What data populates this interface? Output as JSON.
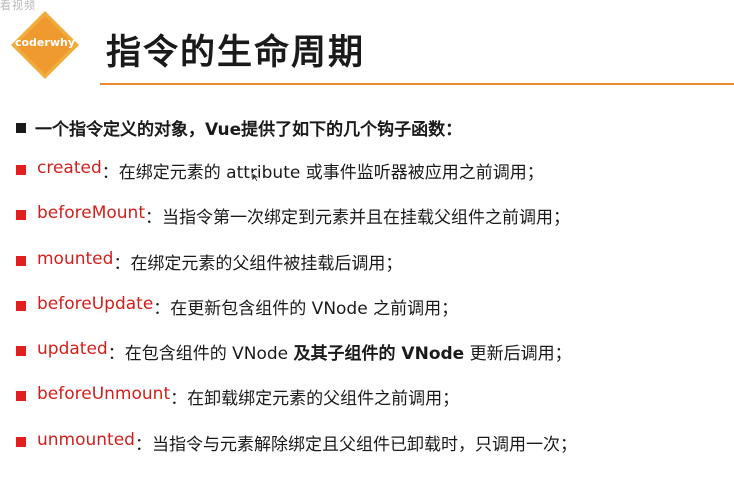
{
  "watermark": "看视频",
  "logo": {
    "text": "coderwhy",
    "color": "#f0ad3c",
    "color_inner": "#ee9a2f"
  },
  "title": "指令的生命周期",
  "accent": "#ed8a2c",
  "intro": "一个指令定义的对象，Vue提供了如下的几个钩子函数：",
  "separator": "：",
  "hooks": [
    {
      "name": "created",
      "desc": "在绑定元素的 attribute 或事件监听器被应用之前调用；"
    },
    {
      "name": "beforeMount",
      "desc": "当指令第一次绑定到元素并且在挂载父组件之前调用；"
    },
    {
      "name": "mounted",
      "desc": "在绑定元素的父组件被挂载后调用；"
    },
    {
      "name": "beforeUpdate",
      "desc": "在更新包含组件的 VNode 之前调用；"
    },
    {
      "name": "updated",
      "desc_before": "在包含组件的 VNode ",
      "desc_bold": "及其子组件的 VNode",
      "desc_after": " 更新后调用；"
    },
    {
      "name": "beforeUnmount",
      "desc": "在卸载绑定元素的父组件之前调用；"
    },
    {
      "name": "unmounted",
      "desc": "当指令与元素解除绑定且父组件已卸载时，只调用一次；"
    }
  ]
}
